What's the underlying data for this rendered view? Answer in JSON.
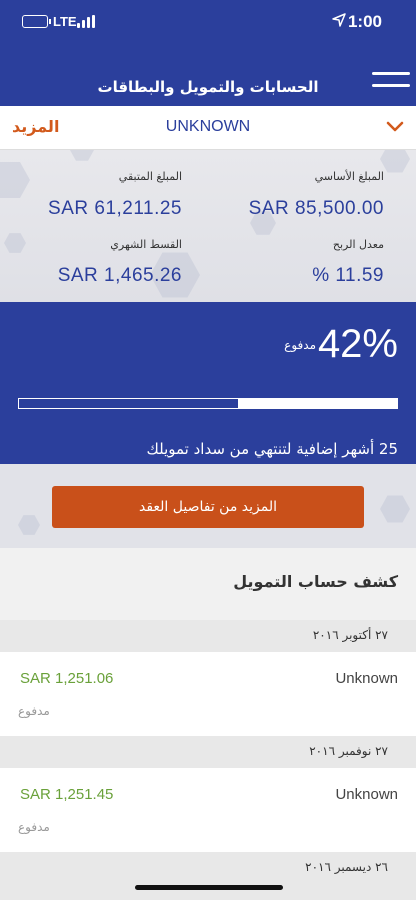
{
  "status_bar": {
    "time": "1:00",
    "network": "LTE"
  },
  "header": {
    "title": "الحسابات والتمويل والبطاقات"
  },
  "account": {
    "more_label": "المزيد",
    "name": "UNKNOWN"
  },
  "summary": {
    "original_amount_label": "المبلغ الأساسي",
    "original_amount": "SAR 85,500.00",
    "remaining_amount_label": "المبلغ المتبقي",
    "remaining_amount": "SAR 61,211.25",
    "profit_rate_label": "معدل الربح",
    "profit_rate": "% 11.59",
    "monthly_installment_label": "القسط الشهري",
    "monthly_installment": "SAR 1,465.26"
  },
  "progress": {
    "percent_text": "42%",
    "paid_label": "مدفوع",
    "paid_fraction": 0.42,
    "remaining_text": "25 أشهر إضافية لتنتهي من سداد تمويلك"
  },
  "contract_button": {
    "label": "المزيد من تفاصيل العقد"
  },
  "statement": {
    "title": "كشف حساب التمويل",
    "entries": [
      {
        "date": "٢٧ أكتوبر ٢٠١٦",
        "name": "Unknown",
        "amount": "SAR 1,251.06",
        "status": "مدفوع"
      },
      {
        "date": "٢٧ نوفمبر ٢٠١٦",
        "name": "Unknown",
        "amount": "SAR 1,251.45",
        "status": "مدفوع"
      },
      {
        "date": "٢٦ ديسمبر ٢٠١٦"
      }
    ]
  },
  "colors": {
    "primary": "#2b3f9c",
    "accent": "#c9501a",
    "positive": "#6aa13a"
  },
  "icons": [
    "location-arrow-icon",
    "battery-icon",
    "signal-icon",
    "hamburger-menu-icon",
    "chevron-down-icon"
  ]
}
